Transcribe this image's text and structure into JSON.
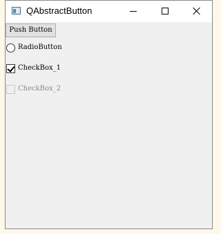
{
  "window": {
    "title": "QAbstractButton",
    "icon": "qt-window-icon",
    "controls": {
      "minimize": "minimize-icon",
      "maximize": "maximize-icon",
      "close": "close-icon"
    }
  },
  "widgets": {
    "push_button": {
      "label": "Push Button"
    },
    "radio_button": {
      "label": "RadioButton",
      "checked": false
    },
    "checkbox_1": {
      "label": "CheckBox_1",
      "checked": true,
      "enabled": true
    },
    "checkbox_2": {
      "label": "CheckBox_2",
      "checked": false,
      "enabled": false
    }
  },
  "colors": {
    "window_bg": "#f0f0f0",
    "titlebar_bg": "#ffffff",
    "disabled_text": "#8a8a8a"
  }
}
